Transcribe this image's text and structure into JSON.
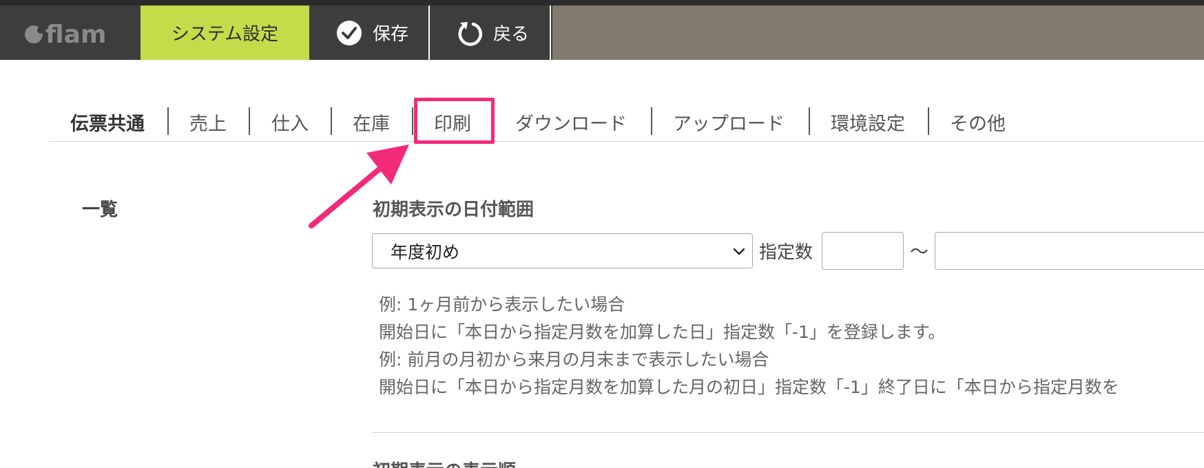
{
  "header": {
    "logo_text": "flam",
    "system_tab_label": "システム設定",
    "save_label": "保存",
    "back_label": "戻る"
  },
  "subnav": {
    "items": [
      {
        "label": "伝票共通",
        "active": true
      },
      {
        "label": "売上"
      },
      {
        "label": "仕入"
      },
      {
        "label": "在庫"
      },
      {
        "label": "印刷",
        "highlighted": true
      },
      {
        "label": "ダウンロード"
      },
      {
        "label": "アップロード"
      },
      {
        "label": "環境設定"
      },
      {
        "label": "その他"
      }
    ]
  },
  "sidebar": {
    "title": "一覧"
  },
  "date_range": {
    "title": "初期表示の日付範囲",
    "select_value": "年度初め",
    "count_label": "指定数",
    "count_value": "",
    "tilde": "〜",
    "end_value": ""
  },
  "help_lines": [
    "例: 1ヶ月前から表示したい場合",
    "開始日に「本日から指定月数を加算した日」指定数「-1」を登録します。",
    "例: 前月の月初から来月の月末まで表示したい場合",
    "開始日に「本日から指定月数を加算した月の初日」指定数「-1」終了日に「本日から指定月数を"
  ],
  "next_section": {
    "title": "初期表示の表示順"
  },
  "colors": {
    "topbar": "#3d3d3d",
    "active_tab": "#c5dc4a",
    "header_filler": "#827a6e",
    "annotation": "#f22a7a"
  },
  "icons": {
    "save": "check-circle-icon",
    "back": "rotate-back-icon",
    "select": "chevron-down-icon",
    "annotation": "pointer-arrow-icon"
  }
}
